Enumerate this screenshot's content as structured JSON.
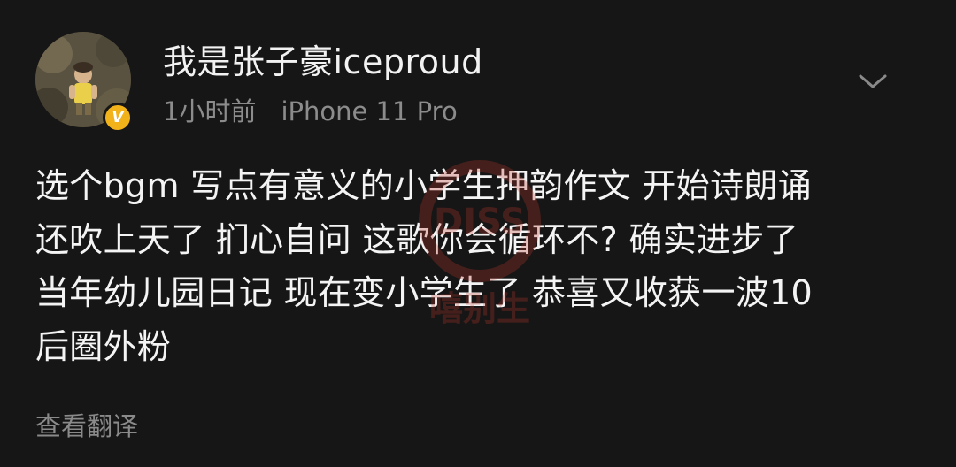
{
  "post": {
    "author": {
      "name": "我是张子豪iceproud",
      "verified_badge": "V"
    },
    "meta": {
      "time": "1小时前",
      "device": "iPhone 11 Pro"
    },
    "content_lines": [
      "选个bgm 写点有意义的小学生押韵作文 开始诗朗诵",
      "还吹上天了 扪心自问 这歌你会循环不? 确实进步了",
      "当年幼儿园日记 现在变小学生了 恭喜又收获一波10",
      "后圈外粉"
    ],
    "translate_label": "查看翻译"
  },
  "watermark": {
    "badge_text": "DISS",
    "caption": "嘻别生"
  },
  "colors": {
    "background": "#161616",
    "text": "#f4f4f4",
    "secondary": "#8c8c8c",
    "badge": "#f2b21a",
    "watermark": "#c0392b"
  },
  "icons": {
    "more": "chevron-down-icon",
    "verified": "verified-badge-icon"
  }
}
